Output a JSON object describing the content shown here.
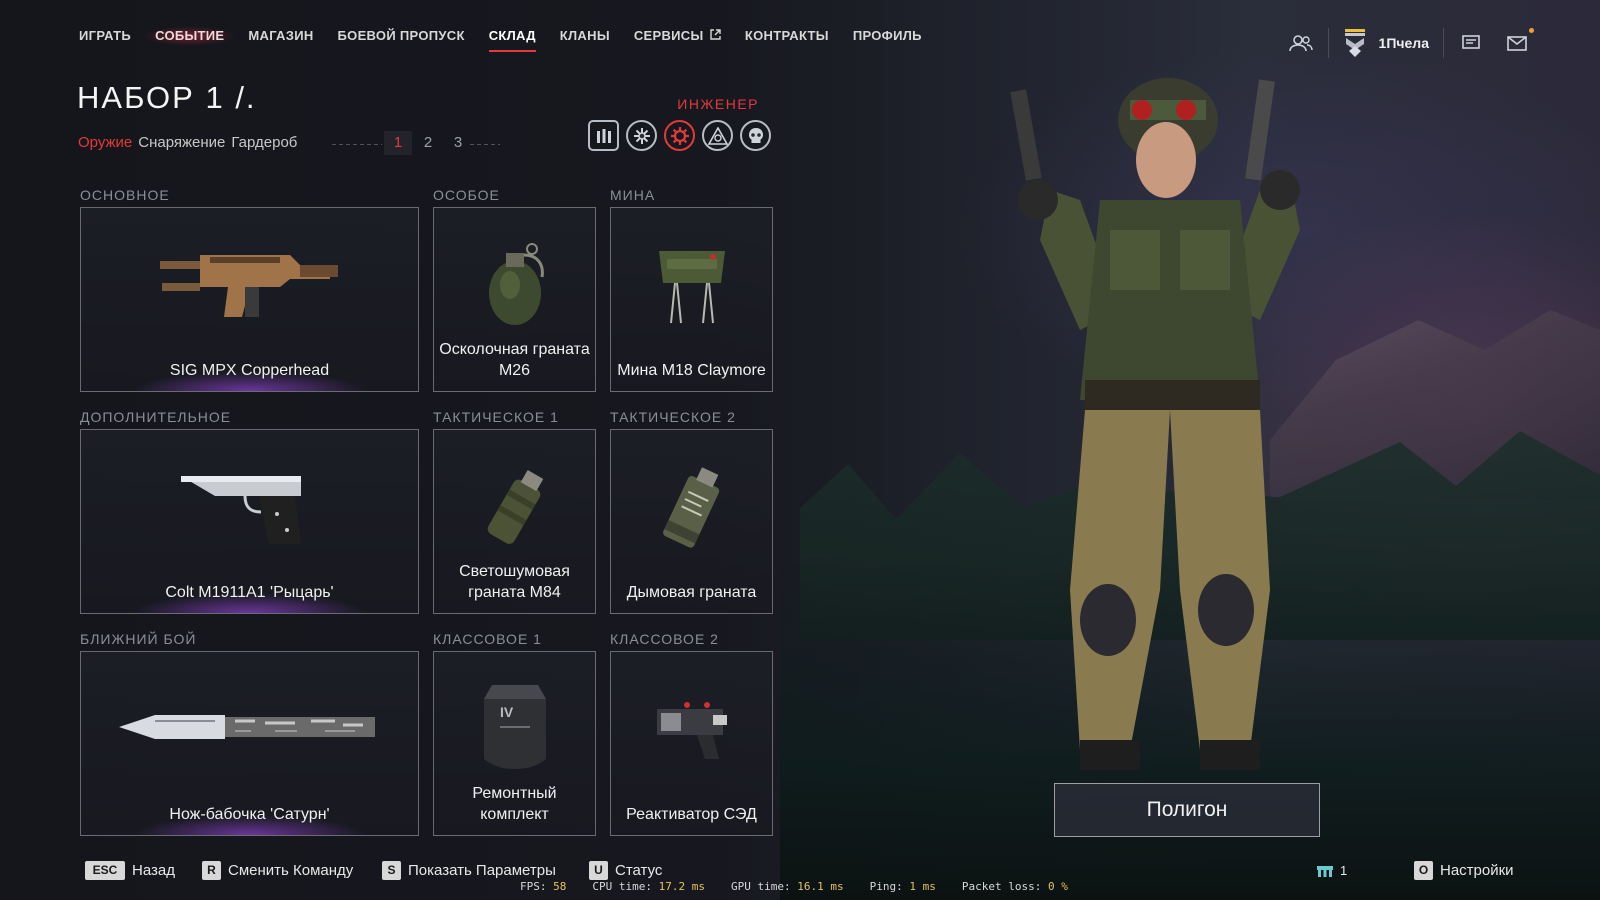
{
  "nav": {
    "items": [
      {
        "label": "ИГРАТЬ"
      },
      {
        "label": "СОБЫТИЕ"
      },
      {
        "label": "МАГАЗИН"
      },
      {
        "label": "БОЕВОЙ ПРОПУСК"
      },
      {
        "label": "СКЛАД"
      },
      {
        "label": "КЛАНЫ"
      },
      {
        "label": "СЕРВИСЫ"
      },
      {
        "label": "КОНТРАКТЫ"
      },
      {
        "label": "ПРОФИЛЬ"
      }
    ],
    "active": "СКЛАД",
    "highlighted": "СОБЫТИЕ"
  },
  "topbar": {
    "username": "1Пчела",
    "icons": [
      "friends-icon",
      "rank-badge-icon",
      "chat-icon",
      "mail-icon"
    ]
  },
  "kit": {
    "title": "НАБОР 1 /.",
    "tabs": [
      "Оружие",
      "Снаряжение",
      "Гардероб"
    ],
    "active_tab": "Оружие",
    "numbers": [
      "1",
      "2",
      "3"
    ],
    "active_number": "1"
  },
  "class_selector": {
    "label": "ИНЖЕНЕР",
    "icons": [
      "rifleman-class-icon",
      "medic-class-icon",
      "engineer-class-icon",
      "sniper-class-icon",
      "skull-class-icon"
    ],
    "active": "engineer-class-icon"
  },
  "loadout": {
    "primary": {
      "section": "ОСНОВНОЕ",
      "item": "SIG MPX Copperhead"
    },
    "special": {
      "section": "ОСОБОЕ",
      "item_line1": "Осколочная граната",
      "item_line2": "M26"
    },
    "mine": {
      "section": "МИНА",
      "item": "Мина M18 Claymore"
    },
    "secondary": {
      "section": "ДОПОЛНИТЕЛЬНОЕ",
      "item": "Colt M1911A1 'Рыцарь'"
    },
    "tactical1": {
      "section": "ТАКТИЧЕСКОЕ 1",
      "item_line1": "Светошумовая",
      "item_line2": "граната M84"
    },
    "tactical2": {
      "section": "ТАКТИЧЕСКОЕ 2",
      "item": "Дымовая граната"
    },
    "melee": {
      "section": "БЛИЖНИЙ БОЙ",
      "item": "Нож-бабочка 'Сатурн'"
    },
    "class1": {
      "section": "КЛАССОВОЕ 1",
      "item_line1": "Ремонтный",
      "item_line2": "комплект"
    },
    "class2": {
      "section": "КЛАССОВОЕ 2",
      "item": "Реактиватор СЭД"
    }
  },
  "polygon_button": "Полигон",
  "hints": {
    "back": {
      "key": "ESC",
      "label": "Назад"
    },
    "team": {
      "key": "R",
      "label": "Сменить Команду"
    },
    "params": {
      "key": "S",
      "label": "Показать Параметры"
    },
    "status": {
      "key": "U",
      "label": "Статус"
    },
    "settings": {
      "key": "O",
      "label": "Настройки"
    }
  },
  "network": {
    "players": "1"
  },
  "stats": {
    "fps_label": "FPS:",
    "fps": "58",
    "cpu_label": "CPU time:",
    "cpu": "17.2",
    "cpu_unit": "ms",
    "gpu_label": "GPU time:",
    "gpu": "16.1",
    "gpu_unit": "ms",
    "ping_label": "Ping:",
    "ping": "1",
    "ping_unit": "ms",
    "loss_label": "Packet loss:",
    "loss": "0",
    "loss_unit": "%"
  }
}
